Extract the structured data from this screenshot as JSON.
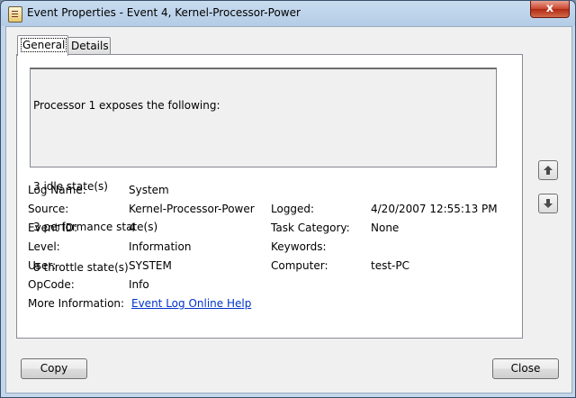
{
  "window": {
    "title": "Event Properties - Event 4, Kernel-Processor-Power",
    "close_glyph": "x"
  },
  "tabs": [
    {
      "label": "General",
      "active": true
    },
    {
      "label": "Details",
      "active": false
    }
  ],
  "description_lines": [
    "Processor 1 exposes the following:",
    "",
    "3 idle state(s)",
    "3 performance state(s)",
    "8 throttle state(s)"
  ],
  "fields": {
    "log_name": {
      "label": "Log Name:",
      "value": "System"
    },
    "source": {
      "label": "Source:",
      "value": "Kernel-Processor-Power"
    },
    "logged": {
      "label": "Logged:",
      "value": "4/20/2007 12:55:13 PM"
    },
    "event_id": {
      "label": "Event ID:",
      "value": "4"
    },
    "task_category": {
      "label": "Task Category:",
      "value": "None"
    },
    "level": {
      "label": "Level:",
      "value": "Information"
    },
    "keywords": {
      "label": "Keywords:",
      "value": ""
    },
    "user": {
      "label": "User:",
      "value": "SYSTEM"
    },
    "computer": {
      "label": "Computer:",
      "value": "test-PC"
    },
    "opcode": {
      "label": "OpCode:",
      "value": "Info"
    },
    "more_info": {
      "label": "More Information:",
      "value": "Event Log Online Help"
    }
  },
  "buttons": {
    "copy": "Copy",
    "close": "Close"
  },
  "icons": {
    "up": "arrow-up-icon",
    "down": "arrow-down-icon"
  }
}
